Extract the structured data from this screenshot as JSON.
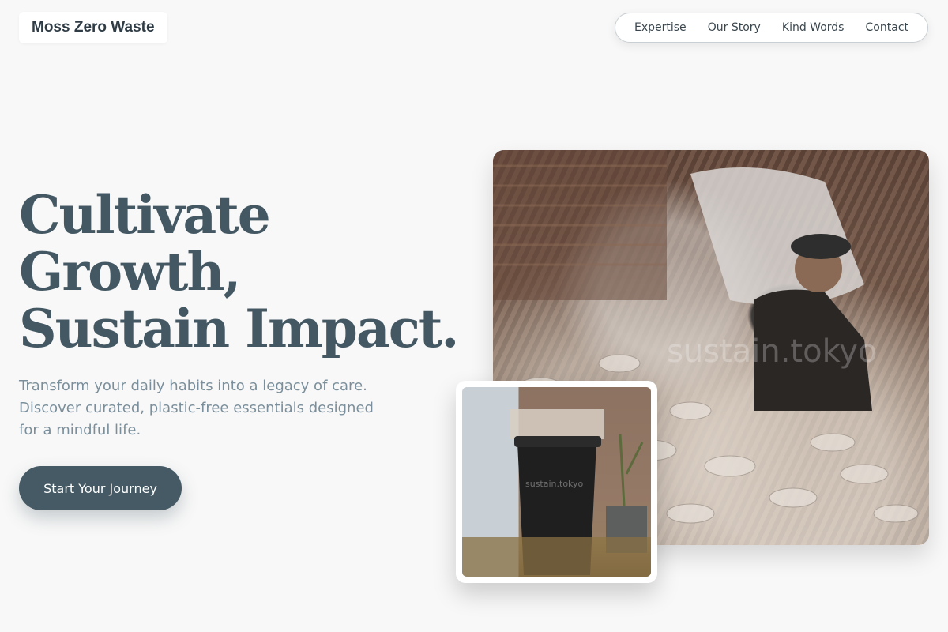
{
  "brand": {
    "name": "Moss Zero Waste"
  },
  "nav": {
    "items": [
      "Expertise",
      "Our Story",
      "Kind Words",
      "Contact"
    ]
  },
  "hero": {
    "headline_lines": [
      "Cultivate",
      "Growth,",
      "Sustain Impact."
    ],
    "subtext": "Transform your daily habits into a legacy of care. Discover curated, plastic-free essentials designed for a mindful life.",
    "cta_label": "Start Your Journey"
  },
  "images": {
    "main_watermark": "sustain.tokyo",
    "inset_watermark": "sustain.tokyo"
  },
  "colors": {
    "primary": "#455a64",
    "headline": "#435863",
    "subtext": "#7a8f9b",
    "background": "#f8f8f8"
  }
}
